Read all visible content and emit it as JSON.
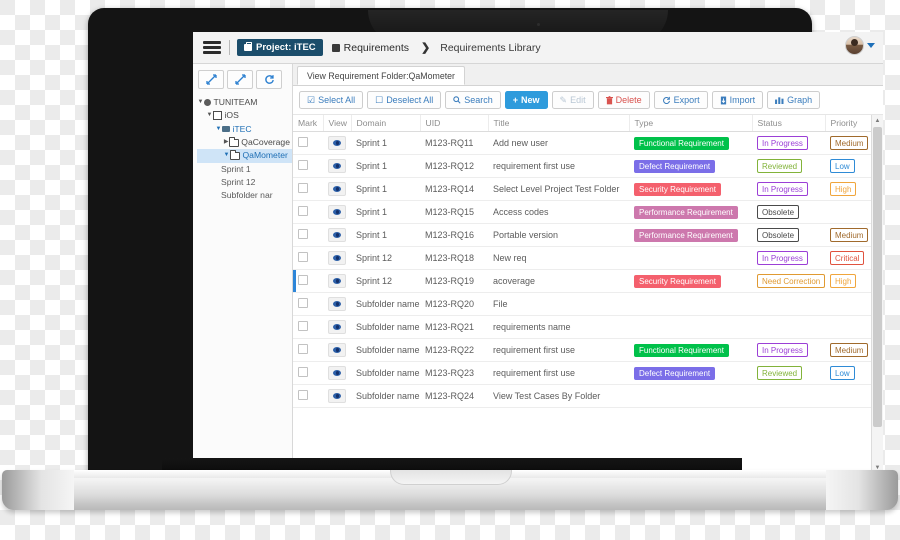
{
  "topbar": {
    "menu_icon": "hamburger-icon",
    "project_pill": "Project: iTEC",
    "crumb_requirements": "Requirements",
    "separator": "❯",
    "page_title": "Requirements Library",
    "avatar_icon": "user-avatar",
    "caret_icon": "chevron-down-icon"
  },
  "sidebar": {
    "tools": [
      {
        "name": "expand-all-button",
        "glyph": "↙"
      },
      {
        "name": "collapse-all-button",
        "glyph": "↙"
      },
      {
        "name": "refresh-button",
        "glyph": "↻"
      }
    ],
    "tree": [
      {
        "label": "TUNITEAM",
        "icon": "globe-icon",
        "depth": 0,
        "twisty": "▼",
        "selected": false
      },
      {
        "label": "iOS",
        "icon": "box-icon",
        "depth": 1,
        "twisty": "▼",
        "selected": false
      },
      {
        "label": "iTEC",
        "icon": "briefcase-icon",
        "depth": 2,
        "twisty": "▼",
        "selected": false
      },
      {
        "label": "QaCoverage",
        "icon": "folder-icon",
        "depth": 3,
        "twisty": "▶",
        "selected": false
      },
      {
        "label": "QaMometer",
        "icon": "folder-icon",
        "depth": 3,
        "twisty": "▼",
        "selected": true
      },
      {
        "label": "Sprint 1",
        "icon": "none",
        "depth": 4,
        "twisty": "",
        "selected": false
      },
      {
        "label": "Sprint 12",
        "icon": "none",
        "depth": 4,
        "twisty": "",
        "selected": false
      },
      {
        "label": "Subfolder nar",
        "icon": "none",
        "depth": 4,
        "twisty": "",
        "selected": false
      }
    ]
  },
  "main": {
    "tab_label": "View Requirement Folder:QaMometer",
    "toolbar": [
      {
        "name": "select-all-button",
        "label": "Select All",
        "glyph": "☑",
        "style": "normal"
      },
      {
        "name": "deselect-all-button",
        "label": "Deselect All",
        "glyph": "☐",
        "style": "normal"
      },
      {
        "name": "search-button",
        "label": "Search",
        "glyph": "⌕",
        "style": "normal"
      },
      {
        "name": "new-button",
        "label": "New",
        "glyph": "+",
        "style": "primary"
      },
      {
        "name": "edit-button",
        "label": "Edit",
        "glyph": "✎",
        "style": "disabled"
      },
      {
        "name": "delete-button",
        "label": "Delete",
        "glyph": "Ὕ1",
        "style": "danger"
      },
      {
        "name": "export-button",
        "label": "Export",
        "glyph": "↻",
        "style": "normal"
      },
      {
        "name": "import-button",
        "label": "Import",
        "glyph": "↓",
        "style": "normal"
      },
      {
        "name": "graph-button",
        "label": "Graph",
        "glyph": "█",
        "style": "normal"
      }
    ],
    "columns": [
      "Mark",
      "View",
      "Domain",
      "UID",
      "Title",
      "Type",
      "Status",
      "Priority"
    ],
    "rows": [
      {
        "domain": "Sprint 1",
        "uid": "M123-RQ11",
        "title": "Add new user",
        "type": "Functional Requirement",
        "type_color": "#00c14a",
        "status": "In Progress",
        "status_color": "#9b3fd6",
        "priority": "Medium",
        "priority_color": "#a06a2c",
        "highlight": false
      },
      {
        "domain": "Sprint 1",
        "uid": "M123-RQ12",
        "title": "requirement first use",
        "type": "Defect Requirement",
        "type_color": "#7b6ee8",
        "status": "Reviewed",
        "status_color": "#82b33a",
        "priority": "Low",
        "priority_color": "#2f8bd6",
        "highlight": false
      },
      {
        "domain": "Sprint 1",
        "uid": "M123-RQ14",
        "title": "Select Level Project Test Folder",
        "type": "Security Requirement",
        "type_color": "#f4606d",
        "status": "In Progress",
        "status_color": "#9b3fd6",
        "priority": "High",
        "priority_color": "#f0a53c",
        "highlight": false
      },
      {
        "domain": "Sprint 1",
        "uid": "M123-RQ15",
        "title": "Access codes",
        "type": "Performance Requirement",
        "type_color": "#cd78ad",
        "status": "Obsolete",
        "status_color": "#4a4a4a",
        "priority": "",
        "priority_color": "",
        "highlight": false
      },
      {
        "domain": "Sprint 1",
        "uid": "M123-RQ16",
        "title": "Portable version",
        "type": "Performance Requirement",
        "type_color": "#cd78ad",
        "status": "Obsolete",
        "status_color": "#4a4a4a",
        "priority": "Medium",
        "priority_color": "#a06a2c",
        "highlight": false
      },
      {
        "domain": "Sprint 12",
        "uid": "M123-RQ18",
        "title": "New req",
        "type": "",
        "type_color": "",
        "status": "In Progress",
        "status_color": "#9b3fd6",
        "priority": "Critical",
        "priority_color": "#e0523e",
        "highlight": false
      },
      {
        "domain": "Sprint 12",
        "uid": "M123-RQ19",
        "title": "acoverage",
        "type": "Security Requirement",
        "type_color": "#f4606d",
        "status": "Need Correction",
        "status_color": "#e09a32",
        "priority": "High",
        "priority_color": "#f0a53c",
        "highlight": true
      },
      {
        "domain": "Subfolder name",
        "uid": "M123-RQ20",
        "title": "File",
        "type": "",
        "type_color": "",
        "status": "",
        "status_color": "",
        "priority": "",
        "priority_color": "",
        "highlight": false
      },
      {
        "domain": "Subfolder name",
        "uid": "M123-RQ21",
        "title": "requirements name",
        "type": "",
        "type_color": "",
        "status": "",
        "status_color": "",
        "priority": "",
        "priority_color": "",
        "highlight": false
      },
      {
        "domain": "Subfolder name",
        "uid": "M123-RQ22",
        "title": "requirement first use",
        "type": "Functional Requirement",
        "type_color": "#00c14a",
        "status": "In Progress",
        "status_color": "#9b3fd6",
        "priority": "Medium",
        "priority_color": "#a06a2c",
        "highlight": false
      },
      {
        "domain": "Subfolder name",
        "uid": "M123-RQ23",
        "title": "requirement first use",
        "type": "Defect Requirement",
        "type_color": "#7b6ee8",
        "status": "Reviewed",
        "status_color": "#82b33a",
        "priority": "Low",
        "priority_color": "#2f8bd6",
        "highlight": false
      },
      {
        "domain": "Subfolder name",
        "uid": "M123-RQ24",
        "title": "View Test Cases By Folder",
        "type": "",
        "type_color": "",
        "status": "",
        "status_color": "",
        "priority": "",
        "priority_color": "",
        "highlight": false
      }
    ],
    "scrollbar": {
      "up_glyph": "▲",
      "down_glyph": "▼"
    }
  }
}
